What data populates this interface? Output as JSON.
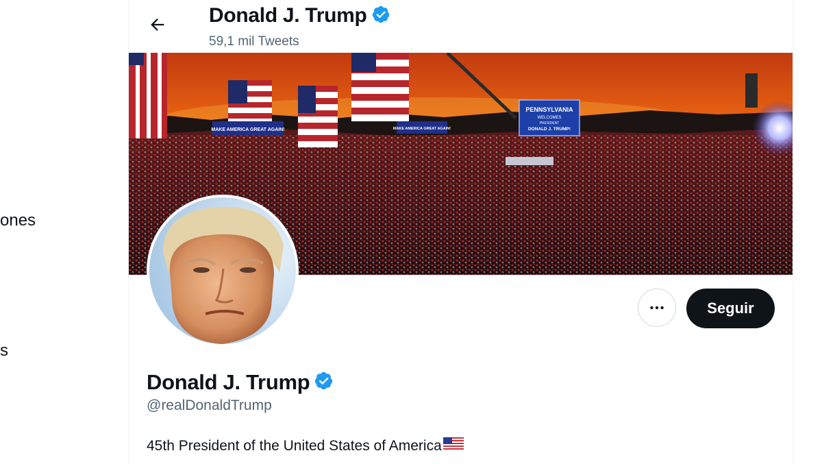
{
  "sidebar": {
    "fragment_1": "ones",
    "fragment_2": "s"
  },
  "header": {
    "name": "Donald J. Trump",
    "tweet_count": "59,1 mil Tweets"
  },
  "banner": {
    "signs": [
      "MAKE AMERICA GREAT AGAIN!",
      "MAKE AMERICA GREAT AGAIN!"
    ],
    "screen_lines": [
      "PENNSYLVANIA",
      "WELCOMES",
      "PRESIDENT",
      "DONALD J. TRUMP!"
    ]
  },
  "actions": {
    "more_label": "⋯",
    "follow_label": "Seguir"
  },
  "profile": {
    "name": "Donald J. Trump",
    "handle": "@realDonaldTrump",
    "bio": "45th President of the United States of America",
    "verified": true
  },
  "colors": {
    "accent_blue": "#1d9bf0",
    "text_primary": "#0f1419",
    "text_secondary": "#536471",
    "button_dark": "#0f1419"
  },
  "icons": {
    "back": "arrow-left-icon",
    "verified": "verified-badge-icon",
    "more": "more-horizontal-icon",
    "flag": "us-flag-emoji"
  }
}
